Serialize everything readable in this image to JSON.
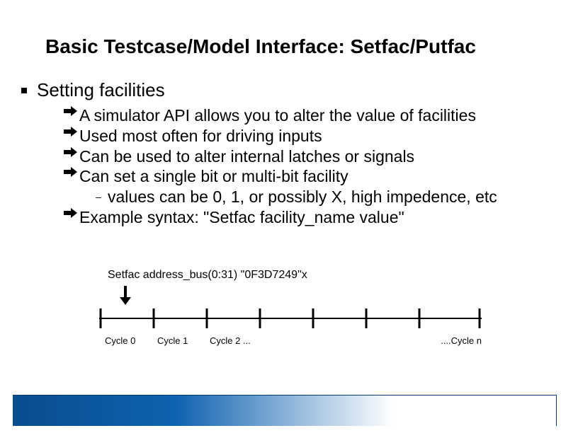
{
  "title": "Basic Testcase/Model Interface: Setfac/Putfac",
  "heading": "Setting facilities",
  "bullets": [
    "A simulator API allows you to alter the value of facilities",
    "Used most often for driving inputs",
    "Can be used to alter internal latches or signals",
    "Can set a single bit or multi-bit facility"
  ],
  "sub_bullet": "values can be 0, 1, or possibly X, high impedence, etc",
  "bullet_last": "Example syntax:  \"Setfac facility_name value\"",
  "setfac_cmd": "Setfac address_bus(0:31)  \"0F3D7249\"x",
  "cycles": {
    "c0": "Cycle 0",
    "c1": "Cycle 1",
    "c2": "Cycle 2  ...",
    "cn": "....Cycle n"
  }
}
